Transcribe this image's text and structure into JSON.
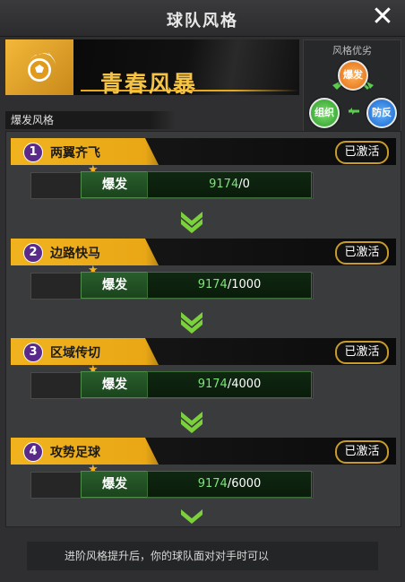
{
  "header": {
    "title": "球队风格",
    "close_icon": "close-icon"
  },
  "banner": {
    "style_name": "青春风暴",
    "icon": "flaming-football-icon",
    "accent": "#f3b83a"
  },
  "advantage": {
    "title": "风格优劣",
    "nodes": {
      "burst": "爆发",
      "organize": "组织",
      "defense": "防反"
    }
  },
  "section_label": "爆发风格",
  "stages": [
    {
      "num": "1",
      "name": "两翼齐飞",
      "status": "已激活",
      "stat_label": "爆发",
      "current": "9174",
      "required": "/0"
    },
    {
      "num": "2",
      "name": "边路快马",
      "status": "已激活",
      "stat_label": "爆发",
      "current": "9174",
      "required": "/1000"
    },
    {
      "num": "3",
      "name": "区域传切",
      "status": "已激活",
      "stat_label": "爆发",
      "current": "9174",
      "required": "/4000"
    },
    {
      "num": "4",
      "name": "攻势足球",
      "status": "已激活",
      "stat_label": "爆发",
      "current": "9174",
      "required": "/6000"
    }
  ],
  "footer": "进阶风格提升后，你的球队面对对手时可以"
}
